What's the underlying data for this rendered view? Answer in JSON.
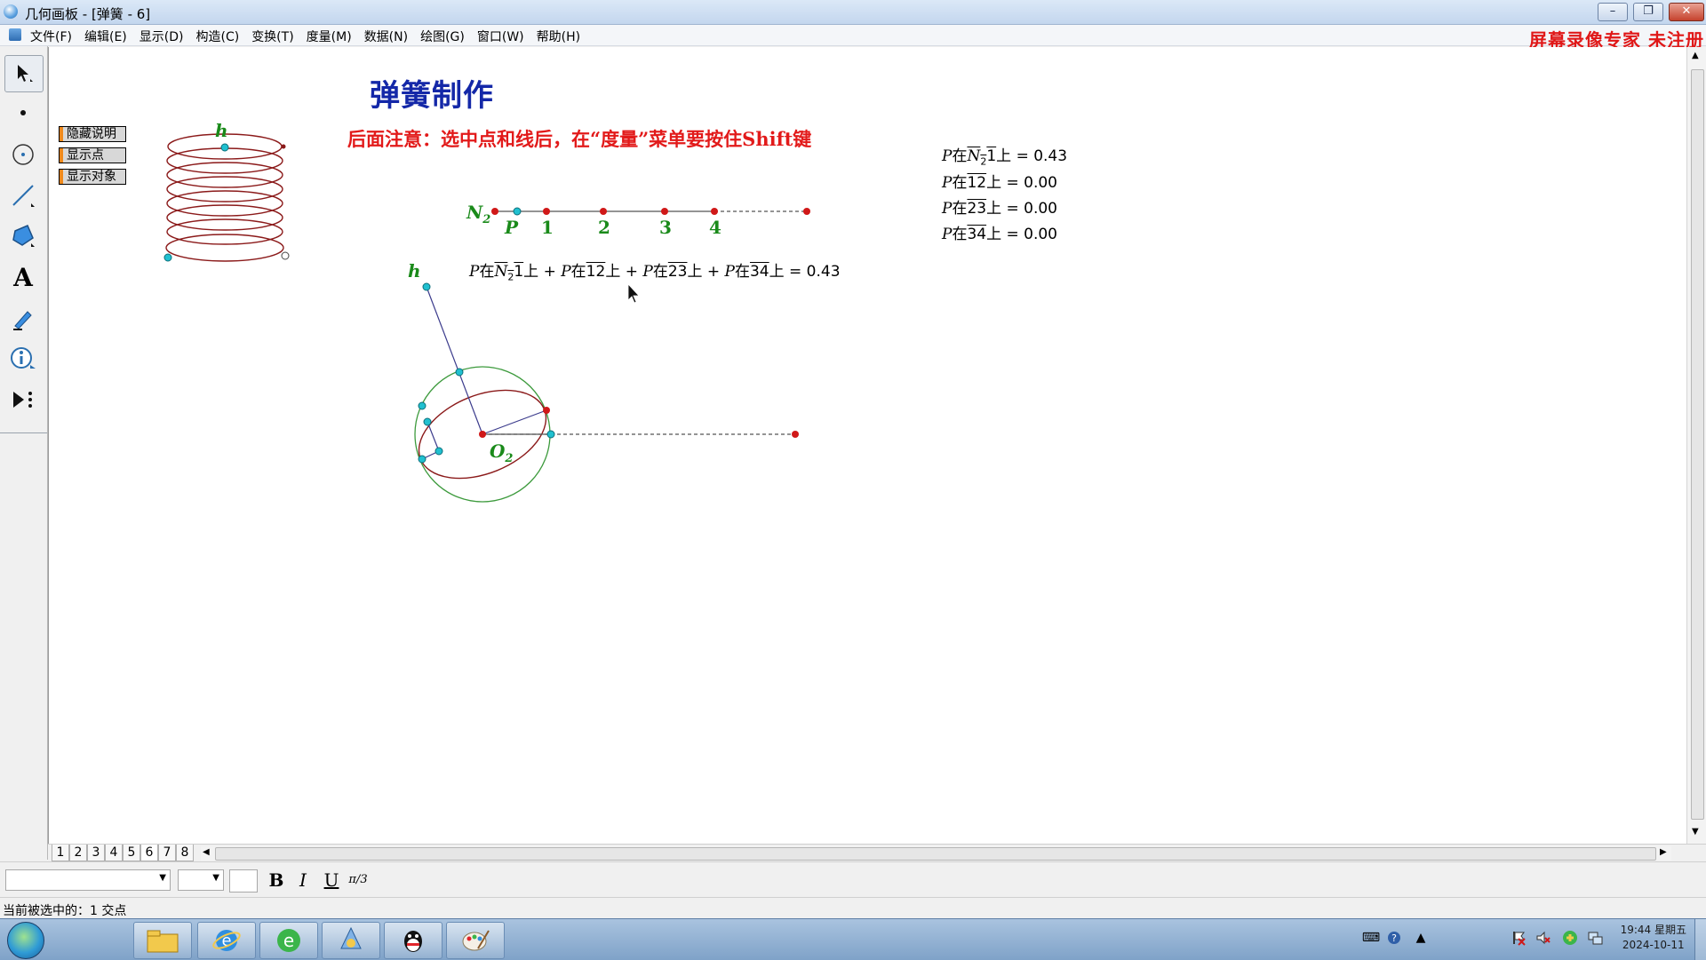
{
  "window": {
    "title": "几何画板 - [弹簧 - 6]",
    "minimize": "–",
    "restore": "❐",
    "close": "✕"
  },
  "menu": {
    "items": [
      "文件(F)",
      "编辑(E)",
      "显示(D)",
      "构造(C)",
      "变换(T)",
      "度量(M)",
      "数据(N)",
      "绘图(G)",
      "窗口(W)",
      "帮助(H)"
    ]
  },
  "watermark": "屏幕录像专家  未注册",
  "toolbox": {
    "tools": [
      "select-arrow-icon",
      "point-tool-icon",
      "compass-tool-icon",
      "straightedge-tool-icon",
      "polygon-tool-icon",
      "text-tool-icon",
      "marker-tool-icon",
      "information-tool-icon",
      "custom-tool-icon"
    ],
    "text_tool_glyph": "A"
  },
  "canvas": {
    "buttons": [
      "隐藏说明",
      "显示点",
      "显示对象"
    ],
    "title": "弹簧制作",
    "notice": "后面注意：选中点和线后，在“度量”菜单要按住Shift键",
    "labels": {
      "h_top": "h",
      "h_left": "h",
      "N2_main": "N",
      "N2_sub": "2",
      "O2_main": "O",
      "O2_sub": "2",
      "P": "P",
      "pt1": "1",
      "pt2": "2",
      "pt3": "3",
      "pt4": "4"
    },
    "measurements": {
      "m1": {
        "point": "P",
        "on": "在",
        "seg": "N",
        "sub": "2",
        "seg2": "1",
        "tail": "上",
        "value": "= 0.43"
      },
      "m2": {
        "point": "P",
        "on": "在",
        "seg": "12",
        "tail": "上",
        "value": "= 0.00"
      },
      "m3": {
        "point": "P",
        "on": "在",
        "seg": "23",
        "tail": "上",
        "value": "= 0.00"
      },
      "m4": {
        "point": "P",
        "on": "在",
        "seg": "34",
        "tail": "上",
        "value": "= 0.00"
      },
      "sum_value": "= 0.43",
      "plus": "+"
    },
    "colors": {
      "title": "#1428a8",
      "notice": "#e21a1a",
      "label_green": "#1a8a1a",
      "spring": "#8b1a1a",
      "point_red": "#d01818",
      "point_cyan": "#20c0d0"
    }
  },
  "page_tabs": [
    "1",
    "2",
    "3",
    "4",
    "5",
    "6",
    "7",
    "8"
  ],
  "active_page": "6",
  "format_bar": {
    "bold": "B",
    "italic": "I",
    "underline": "U",
    "symbol": "π/3"
  },
  "status": "当前被选中的：1 交点",
  "taskbar": {
    "apps": [
      "file-explorer-icon",
      "internet-explorer-icon",
      "browser-e-icon",
      "sketchpad-icon",
      "qq-icon",
      "paint-icon"
    ],
    "clock_time": "19:44 星期五",
    "clock_date": "2024-10-11"
  }
}
